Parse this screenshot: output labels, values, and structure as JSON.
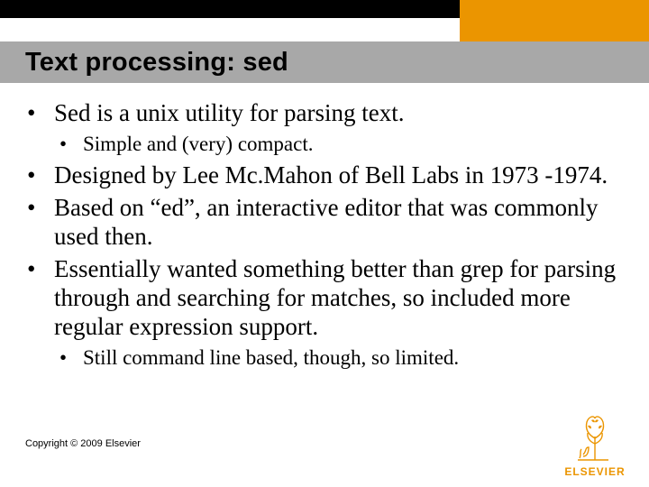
{
  "title": "Text processing: sed",
  "bullets": {
    "b1": "Sed is a unix utility for parsing text.",
    "b1a": "Simple and (very) compact.",
    "b2": "Designed by Lee Mc.Mahon of Bell Labs in 1973 -1974.",
    "b3": "Based on “ed”, an interactive editor that was commonly used then.",
    "b4": "Essentially wanted something better than grep for parsing through and searching for matches, so included more regular expression support.",
    "b4a": "Still command line based, though, so limited."
  },
  "copyright": "Copyright © 2009 Elsevier",
  "logo_text": "ELSEVIER",
  "colors": {
    "orange": "#eb9500",
    "titlebar": "#a8a8a8",
    "black": "#000000"
  }
}
